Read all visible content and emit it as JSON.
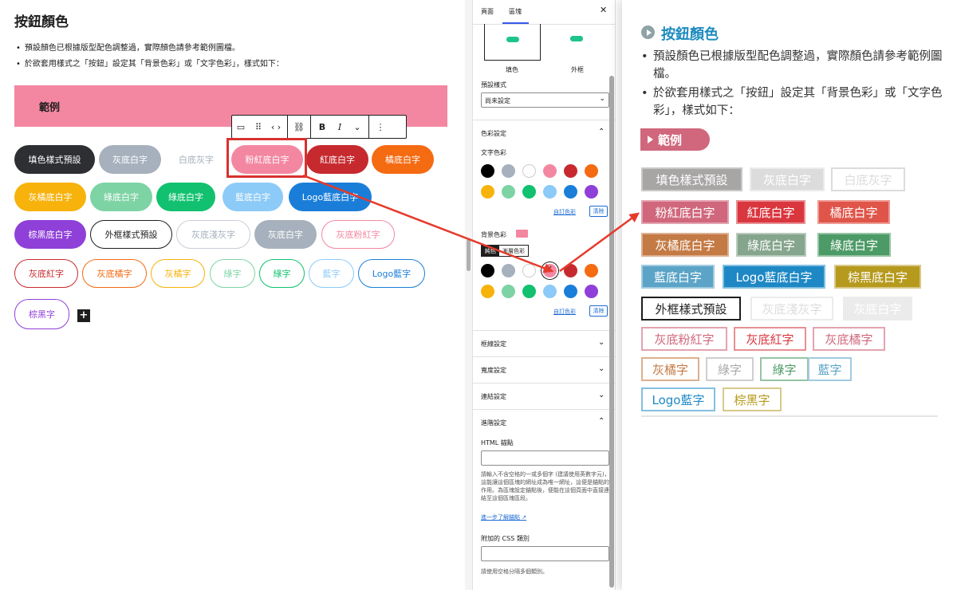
{
  "editor": {
    "title": "按鈕顏色",
    "bullets": [
      "預設顏色已根據版型配色調整過，實際顏色請參考範例圖檔。",
      "於欲套用樣式之「按鈕」設定其「背景色彩」或「文字色彩」，樣式如下："
    ],
    "sample_label": "範例",
    "toolbar": {
      "button_icon": "▭",
      "drag_icon": "⠿",
      "move_icon": "‹ ›",
      "link_icon": "⛓",
      "bold": "B",
      "italic": "I",
      "more_icon": "⌄",
      "options_icon": "⋮"
    },
    "buttons": [
      {
        "label": "填色樣式預設",
        "bg": "#2d2f33",
        "color": "#ffffff",
        "border": "none"
      },
      {
        "label": "灰底白字",
        "bg": "#a6b1bd",
        "color": "#ffffff",
        "border": "none"
      },
      {
        "label": "白底灰字",
        "bg": "#ffffff",
        "color": "#a6b1bd",
        "border": "none"
      },
      {
        "label": "粉紅底白字",
        "bg": "#f387a1",
        "color": "#ffffff",
        "border": "none"
      },
      {
        "label": "紅底白字",
        "bg": "#c62a2f",
        "color": "#ffffff",
        "border": "none"
      },
      {
        "label": "橘底白字",
        "bg": "#f46b12",
        "color": "#ffffff",
        "border": "none"
      },
      {
        "label": "灰橘底白字",
        "bg": "#f7b20c",
        "color": "#ffffff",
        "border": "none"
      },
      {
        "label": "綠底白字",
        "bg": "#7dd3a4",
        "color": "#ffffff",
        "border": "none"
      },
      {
        "label": "綠底白字",
        "bg": "#11c16f",
        "color": "#ffffff",
        "border": "none"
      },
      {
        "label": "藍底白字",
        "bg": "#8ccaf7",
        "color": "#ffffff",
        "border": "none"
      },
      {
        "label": "Logo藍底白字",
        "bg": "#1a7ed9",
        "color": "#ffffff",
        "border": "none"
      },
      {
        "label": "棕黑底白字",
        "bg": "#8f40d8",
        "color": "#ffffff",
        "border": "none"
      },
      {
        "label": "外框樣式預設",
        "bg": "#ffffff",
        "color": "#1e1e1e",
        "border": "#1e1e1e"
      },
      {
        "label": "灰底淺灰字",
        "bg": "#ffffff",
        "color": "#a6b1bd",
        "border": "#c8ced6"
      },
      {
        "label": "灰底白字",
        "bg": "#a6b1bd",
        "color": "#ffffff",
        "border": "none"
      },
      {
        "label": "灰底粉紅字",
        "bg": "#ffffff",
        "color": "#f387a1",
        "border": "#f387a1"
      },
      {
        "label": "灰底紅字",
        "bg": "#ffffff",
        "color": "#c62a2f",
        "border": "#c62a2f"
      },
      {
        "label": "灰底橘字",
        "bg": "#ffffff",
        "color": "#f46b12",
        "border": "#f46b12"
      },
      {
        "label": "灰橘字",
        "bg": "#ffffff",
        "color": "#f7b20c",
        "border": "#f7b20c"
      },
      {
        "label": "綠字",
        "bg": "#ffffff",
        "color": "#7dd3a4",
        "border": "#7dd3a4"
      },
      {
        "label": "綠字",
        "bg": "#ffffff",
        "color": "#11c16f",
        "border": "#11c16f"
      },
      {
        "label": "藍字",
        "bg": "#ffffff",
        "color": "#8ccaf7",
        "border": "#8ccaf7"
      },
      {
        "label": "Logo藍字",
        "bg": "#ffffff",
        "color": "#1a7ed9",
        "border": "#1a7ed9"
      },
      {
        "label": "棕黑字",
        "bg": "#ffffff",
        "color": "#8f40d8",
        "border": "#8f40d8"
      }
    ]
  },
  "sidebar": {
    "tabs": [
      "頁面",
      "區塊"
    ],
    "close_icon": "✕",
    "style_fill": "填色",
    "style_outline": "外框",
    "preset_label": "預設樣式",
    "preset_value": "尚未設定",
    "color_panel": "色彩設定",
    "text_color_label": "文字色彩",
    "bg_color_label": "背景色彩",
    "bg_tabs": [
      "純色",
      "漸層色彩"
    ],
    "custom_color": "自訂色彩",
    "clear": "清除",
    "swatches": [
      "#000000",
      "#a6b1bd",
      "#ffffff",
      "#f387a1",
      "#c62a2f",
      "#f46b12",
      "#f7b20c",
      "#7dd3a4",
      "#11c16f",
      "#8ccaf7",
      "#1a7ed9",
      "#8f40d8"
    ],
    "panels": [
      "框線設定",
      "寬度設定",
      "連結設定",
      "進階設定"
    ],
    "html_anchor_label": "HTML 錨點",
    "anchor_help": "請輸入不含空格的一或多個字 (建議使用英數字元)，這能讓這個區塊的網址成為唯一網址，這便是錨點的作用。為區塊設定錨點後，便能在這個頁面中直接連結至這個區塊區段。",
    "anchor_link": "進一步了解錨點",
    "css_label": "附加的 CSS 類別",
    "css_help": "請使用空格分隔多個類別。"
  },
  "preview": {
    "title": "按鈕顏色",
    "bullets": [
      "預設顏色已根據版型配色調整過，實際顏色請參考範例圖檔。",
      "於欲套用樣式之「按鈕」設定其「背景色彩」或「文字色彩」，樣式如下："
    ],
    "sample_label": "範例",
    "buttons": [
      {
        "label": "填色樣式預設",
        "bg": "#a8a5a5",
        "color": "#ffffff",
        "border": "#c9c7c7"
      },
      {
        "label": "灰底白字",
        "bg": "#dcdcdc",
        "color": "#ffffff",
        "border": "#ebebeb"
      },
      {
        "label": "白底灰字",
        "bg": "#ffffff",
        "color": "#dcdcdc",
        "border": "#dcdcdc"
      },
      {
        "label": "粉紅底白字",
        "bg": "#d0677c",
        "color": "#ffffff",
        "border": "#e3a3b0"
      },
      {
        "label": "紅底白字",
        "bg": "#d9363e",
        "color": "#ffffff",
        "border": "#e88f93"
      },
      {
        "label": "橘底白字",
        "bg": "#e0554a",
        "color": "#ffffff",
        "border": "#ec9a93"
      },
      {
        "label": "灰橘底白字",
        "bg": "#c47a44",
        "color": "#ffffff",
        "border": "#dcb08f"
      },
      {
        "label": "綠底白字",
        "bg": "#86a58d",
        "color": "#ffffff",
        "border": "#b8cbbc"
      },
      {
        "label": "綠底白字",
        "bg": "#4c9a66",
        "color": "#ffffff",
        "border": "#96c4a5"
      },
      {
        "label": "藍底白字",
        "bg": "#5ba4c7",
        "color": "#ffffff",
        "border": "#a1cbe0"
      },
      {
        "label": "Logo藍底白字",
        "bg": "#1e88c5",
        "color": "#ffffff",
        "border": "#84bfe1"
      },
      {
        "label": "棕黑底白字",
        "bg": "#b69a1d",
        "color": "#ffffff",
        "border": "#d8c88a"
      },
      {
        "label": "外框樣式預設",
        "bg": "#ffffff",
        "color": "#1e1e1e",
        "border": "#1e1e1e"
      },
      {
        "label": "灰底淺灰字",
        "bg": "#ffffff",
        "color": "#dcdcdc",
        "border": "#ebebeb"
      },
      {
        "label": "灰底白字",
        "bg": "#ebebeb",
        "color": "#ffffff",
        "border": "#ebebeb"
      },
      {
        "label": "灰底粉紅字",
        "bg": "#ffffff",
        "color": "#d0677c",
        "border": "#e3a3b0"
      },
      {
        "label": "灰底紅字",
        "bg": "#ffffff",
        "color": "#d9363e",
        "border": "#e88f93"
      },
      {
        "label": "灰底橘字",
        "bg": "#ffffff",
        "color": "#d0677c",
        "border": "#e3a3b0"
      },
      {
        "label": "灰橘字",
        "bg": "#ffffff",
        "color": "#c47a44",
        "border": "#dcb08f"
      },
      {
        "label": "綠字",
        "bg": "#ffffff",
        "color": "#a9a9a9",
        "border": "#cfcfcf"
      },
      {
        "label": "綠字",
        "bg": "#ffffff",
        "color": "#4c9a66",
        "border": "#96c4a5"
      },
      {
        "label": "藍字",
        "bg": "#ffffff",
        "color": "#5ba4c7",
        "border": "#a1cbe0"
      },
      {
        "label": "Logo藍字",
        "bg": "#ffffff",
        "color": "#1e88c5",
        "border": "#84bfe1"
      },
      {
        "label": "棕黑字",
        "bg": "#ffffff",
        "color": "#b69a1d",
        "border": "#d8c88a"
      }
    ]
  },
  "colors": {
    "arrow": "#e53b2c",
    "highlight": "#d7322f",
    "accent": "#3858e9"
  }
}
